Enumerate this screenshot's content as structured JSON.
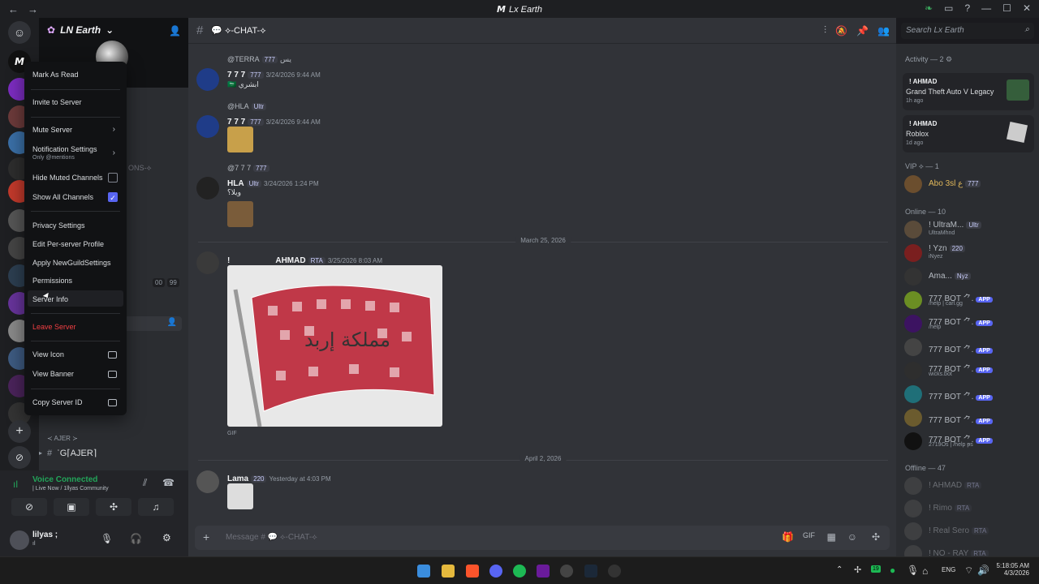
{
  "window": {
    "title": "Lx Earth"
  },
  "server": {
    "name": "LN Earth",
    "faded_text_1": "ONS-⟡"
  },
  "channel": {
    "name": "💬 ⟡-CHAT-⟡",
    "faded_category": "≺ AJER ≻",
    "ajer_channel": "ʿG⌈AJER⌉",
    "count_a": "00",
    "count_b": "99"
  },
  "search": {
    "placeholder": "Search Lx Earth"
  },
  "context_menu": {
    "mark_as_read": "Mark As Read",
    "invite": "Invite to Server",
    "mute": "Mute Server",
    "notifications": "Notification Settings",
    "notifications_sub": "Only @mentions",
    "hide_muted": "Hide Muted Channels",
    "show_all": "Show All Channels",
    "privacy": "Privacy Settings",
    "edit_profile": "Edit Per-server Profile",
    "apply_settings": "Apply NewGuildSettings",
    "permissions": "Permissions",
    "server_info": "Server Info",
    "leave": "Leave Server",
    "view_icon": "View Icon",
    "view_banner": "View Banner",
    "copy_id": "Copy Server ID"
  },
  "messages": [
    {
      "reply_to": "@TERRA",
      "reply_tag": "777",
      "reply_text": "يس",
      "author": "7 7 7",
      "tag": "777",
      "time": "3/24/2026 9:44 AM",
      "text": "ابشري"
    },
    {
      "reply_to": "@HLA",
      "reply_tag": "Ultr",
      "author": "7 7 7",
      "tag": "777",
      "time": "3/24/2026 9:44 AM"
    },
    {
      "reply_to": "@7 7 7",
      "reply_tag": "777",
      "author": "HLA",
      "tag": "Ultr",
      "time": "3/24/2026 1:24 PM",
      "text": "ويلا؟"
    },
    {
      "author": "AHMAD",
      "tag": "RTA",
      "time": "3/25/2026 8:03 AM",
      "gif_label": "GIF",
      "prefix": "!"
    },
    {
      "author": "Lama",
      "tag": "220",
      "time": "Yesterday at 4:03 PM"
    }
  ],
  "dates": {
    "d1": "March 25, 2026",
    "d2": "April 2, 2026"
  },
  "input": {
    "placeholder": "Message # 💬 ⟡-CHAT-⟡"
  },
  "voice": {
    "status": "Voice Connected",
    "sub": "| Live Now / 1llyas Community"
  },
  "user": {
    "name": "lilyas ;",
    "status": "ıl"
  },
  "activity": {
    "header": "Activity — 2",
    "items": [
      {
        "user": "! AHMAD",
        "game": "Grand Theft Auto V Legacy",
        "time": "1h ago"
      },
      {
        "user": "! AHMAD",
        "game": "Roblox",
        "time": "1d ago"
      }
    ]
  },
  "members": {
    "vip_header": "VIP ⟡ — 1",
    "vip": [
      {
        "name": "Abo 3sl ع",
        "tag": "777"
      }
    ],
    "online_header": "Online — 10",
    "online": [
      {
        "name": "! UltraM...",
        "tag": "Ultr",
        "status": "UltraMhnd"
      },
      {
        "name": "! Yzn",
        "tag": "220",
        "status": "iNyez"
      },
      {
        "name": "Ama...",
        "tag": "Nyz"
      },
      {
        "name": "777 BOT ⺈.",
        "app": "APP",
        "status": "/help | carl.gg"
      },
      {
        "name": "777 BOT ⺈.",
        "app": "APP",
        "status": "/help"
      },
      {
        "name": "777 BOT ⺈.",
        "app": "APP"
      },
      {
        "name": "777 BOT ⺈.",
        "app": "APP",
        "status": "wicks.bot"
      },
      {
        "name": "777 BOT ⺈.",
        "app": "APP"
      },
      {
        "name": "777 BOT ⺈.",
        "app": "APP"
      },
      {
        "name": "777 BOT ⺈.",
        "app": "APP",
        "status": "2719Os | /help ᵽs"
      }
    ],
    "offline_header": "Offline — 47",
    "offline": [
      {
        "name": "! AHMAD",
        "tag": "RTA"
      },
      {
        "name": "! Rimo",
        "tag": "RTA"
      },
      {
        "name": "! Real Sero",
        "tag": "RTA"
      },
      {
        "name": "! NO - RAY",
        "tag": "RTA"
      }
    ]
  },
  "taskbar": {
    "lang": "ENG",
    "time": "5:18:05 AM",
    "date": "4/3/2026",
    "badge": "19"
  },
  "colors": {
    "accent": "#5865f2",
    "danger": "#f23f43",
    "online": "#23a55a"
  }
}
